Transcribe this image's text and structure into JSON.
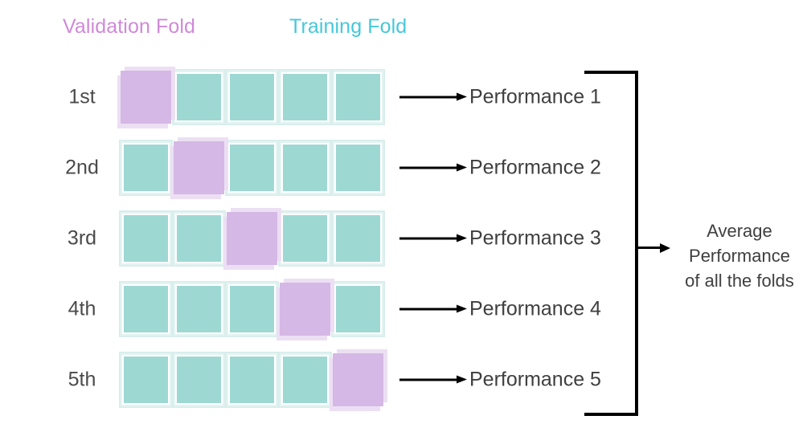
{
  "legend": {
    "validation": {
      "label": "Validation Fold",
      "color": "#d089d8"
    },
    "training": {
      "label": "Training Fold",
      "color": "#45c8d8"
    }
  },
  "colors": {
    "validation_box_fill": "#d5b8e5",
    "validation_box_halo": "#ecdff3",
    "training_box_fill": "#9ed8d3",
    "training_box_border": "#e4f4f2",
    "arrow": "#000000",
    "text": "#3f3f3f",
    "background": "#ffffff"
  },
  "folds": [
    {
      "row_label": "1st",
      "validation_index": 0,
      "num_boxes": 5,
      "performance_label": "Performance 1"
    },
    {
      "row_label": "2nd",
      "validation_index": 1,
      "num_boxes": 5,
      "performance_label": "Performance 2"
    },
    {
      "row_label": "3rd",
      "validation_index": 2,
      "num_boxes": 5,
      "performance_label": "Performance 3"
    },
    {
      "row_label": "4th",
      "validation_index": 3,
      "num_boxes": 5,
      "performance_label": "Performance 4"
    },
    {
      "row_label": "5th",
      "validation_index": 4,
      "num_boxes": 5,
      "performance_label": "Performance 5"
    }
  ],
  "aggregate": {
    "line1": "Average",
    "line2": "Performance",
    "line3": "of all the folds"
  }
}
